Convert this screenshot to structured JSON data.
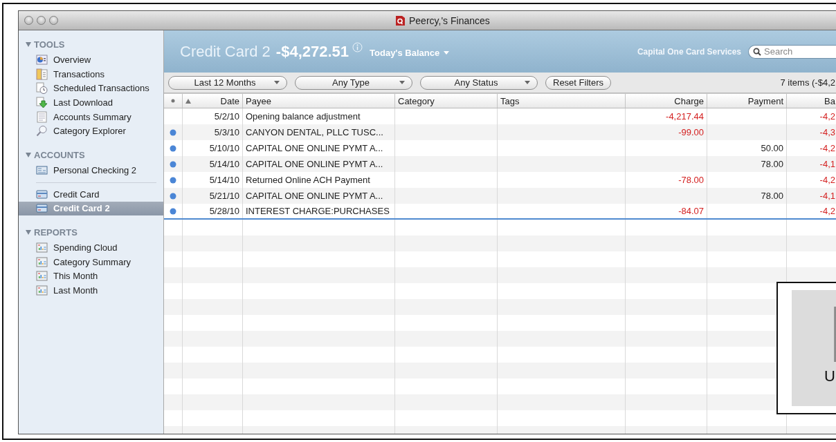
{
  "window": {
    "title": "Peercy,'s Finances"
  },
  "sidebar": {
    "sections": [
      {
        "title": "TOOLS",
        "expanded": true,
        "groups": [
          [
            {
              "label": "Overview",
              "selected": false
            },
            {
              "label": "Transactions",
              "selected": false
            },
            {
              "label": "Scheduled Transactions",
              "selected": false
            },
            {
              "label": "Last Download",
              "selected": false
            },
            {
              "label": "Accounts Summary",
              "selected": false
            },
            {
              "label": "Category Explorer",
              "selected": false
            }
          ]
        ]
      },
      {
        "title": "ACCOUNTS",
        "expanded": true,
        "groups": [
          [
            {
              "label": "Personal Checking 2",
              "selected": false
            }
          ],
          [
            {
              "label": "Credit Card",
              "selected": false
            },
            {
              "label": "Credit Card 2",
              "selected": true
            }
          ]
        ]
      },
      {
        "title": "REPORTS",
        "expanded": true,
        "groups": [
          [
            {
              "label": "Spending Cloud",
              "selected": false
            },
            {
              "label": "Category Summary",
              "selected": false
            },
            {
              "label": "This Month",
              "selected": false
            },
            {
              "label": "Last Month",
              "selected": false
            }
          ]
        ]
      }
    ]
  },
  "header": {
    "account": "Credit Card 2",
    "balance": "-$4,272.51",
    "balance_label": "Today's Balance",
    "institution": "Capital One Card Services",
    "search": {
      "placeholder": "Search"
    }
  },
  "filters": {
    "controls": [
      {
        "kind": "popup",
        "label": "Last 12 Months"
      },
      {
        "kind": "popup",
        "label": "Any Type"
      },
      {
        "kind": "popup",
        "label": "Any Status"
      },
      {
        "kind": "button",
        "label": "Reset Filters"
      }
    ],
    "summary": "7 items (-$4,2"
  },
  "table": {
    "columns": [
      {
        "label": "Date",
        "sorted": true
      },
      {
        "label": "Payee",
        "sorted": false
      },
      {
        "label": "Category",
        "sorted": false
      },
      {
        "label": "Tags",
        "sorted": false
      },
      {
        "label": "Charge",
        "sorted": false
      },
      {
        "label": "Payment",
        "sorted": false
      },
      {
        "label": "Ba",
        "sorted": false
      }
    ],
    "rows": [
      {
        "cleared": false,
        "cells": [
          "5/2/10",
          "Opening balance adjustment",
          null,
          null,
          "-4,217.44",
          null,
          "-4,2"
        ]
      },
      {
        "cleared": true,
        "cells": [
          "5/3/10",
          "CANYON DENTAL, PLLC TUSC...",
          null,
          null,
          "-99.00",
          null,
          "-4,3"
        ]
      },
      {
        "cleared": true,
        "cells": [
          "5/10/10",
          "CAPITAL ONE ONLINE PYMT A...",
          null,
          null,
          null,
          "50.00",
          "-4,2"
        ]
      },
      {
        "cleared": true,
        "cells": [
          "5/14/10",
          "CAPITAL ONE ONLINE PYMT A...",
          null,
          null,
          null,
          "78.00",
          "-4,1"
        ]
      },
      {
        "cleared": true,
        "cells": [
          "5/14/10",
          "Returned Online ACH Payment",
          null,
          null,
          "-78.00",
          null,
          "-4,2"
        ]
      },
      {
        "cleared": true,
        "cells": [
          "5/21/10",
          "CAPITAL ONE ONLINE PYMT A...",
          null,
          null,
          null,
          "78.00",
          "-4,1"
        ]
      },
      {
        "cleared": true,
        "cells": [
          "5/28/10",
          "INTEREST CHARGE:PURCHASES",
          null,
          null,
          "-84.07",
          null,
          "-4,2"
        ]
      }
    ]
  },
  "thumbnail": {
    "label": "U"
  }
}
